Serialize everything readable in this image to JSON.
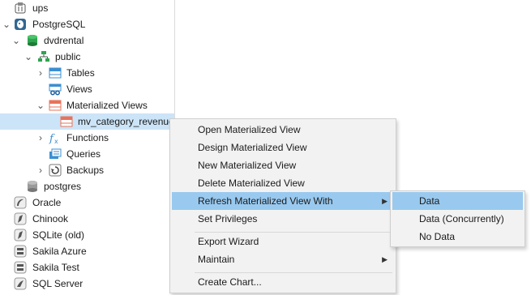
{
  "tree": {
    "ups": "ups",
    "postgresql": "PostgreSQL",
    "dvdrental": "dvdrental",
    "public": "public",
    "tables": "Tables",
    "views": "Views",
    "materialized_views": "Materialized Views",
    "mv_item": "mv_category_revenue",
    "functions": "Functions",
    "queries": "Queries",
    "backups": "Backups",
    "postgres": "postgres",
    "oracle": "Oracle",
    "chinook": "Chinook",
    "sqlite_old": "SQLite (old)",
    "sakila_azure": "Sakila Azure",
    "sakila_test": "Sakila Test",
    "sql_server": "SQL Server"
  },
  "context_menu": {
    "open": "Open Materialized View",
    "design": "Design Materialized View",
    "new": "New Materialized View",
    "delete": "Delete Materialized View",
    "refresh_with": "Refresh Materialized View With",
    "set_privileges": "Set Privileges",
    "export_wizard": "Export Wizard",
    "maintain": "Maintain",
    "create_chart": "Create Chart..."
  },
  "submenu": {
    "data": "Data",
    "data_concurrently": "Data (Concurrently)",
    "no_data": "No Data"
  },
  "colors": {
    "selection": "#cce4f7",
    "menu_highlight": "#99c9ef",
    "menu_bg": "#f2f2f2"
  }
}
